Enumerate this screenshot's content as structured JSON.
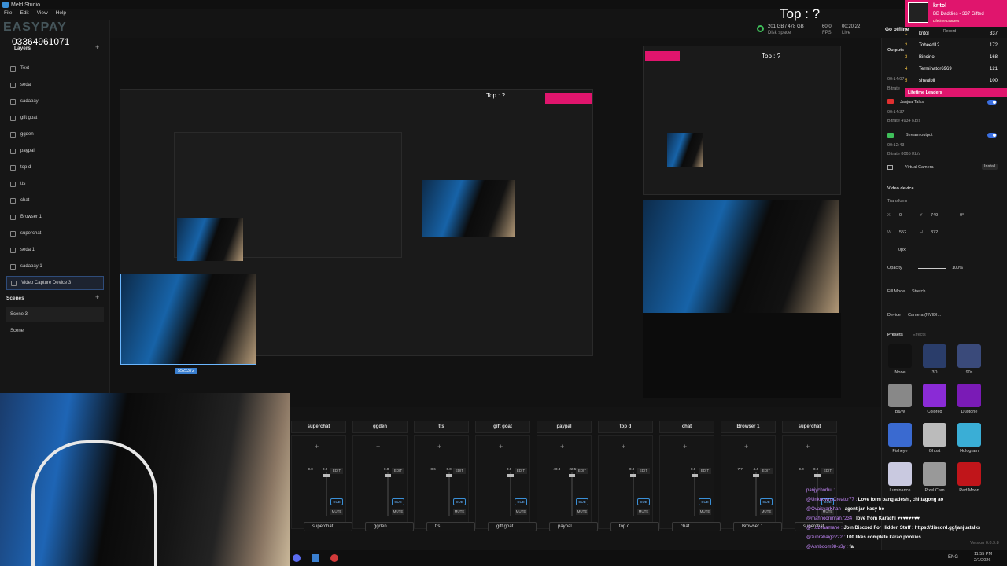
{
  "window": {
    "title": "Meld Studio"
  },
  "menu": [
    "File",
    "Edit",
    "View",
    "Help"
  ],
  "watermark": {
    "brand": "EASYPAY",
    "phone": "03364961071"
  },
  "layers": {
    "title": "Layers",
    "items": [
      "Text",
      "seda",
      "sadapay",
      "gift goat",
      "ggden",
      "paypal",
      "top d",
      "tts",
      "chat",
      "Browser 1",
      "superchat",
      "seda 1",
      "sadapay 1",
      "Video Capture Device 3"
    ]
  },
  "scenes": {
    "title": "Scenes",
    "items": [
      "Scene 3",
      "Scene"
    ]
  },
  "overlay": {
    "top_text": "Top : ?"
  },
  "stats": {
    "disk": "201 GB / 478 GB",
    "disk_label": "Disk space",
    "fps": "60.0",
    "fps_label": "FPS",
    "time": "00:20:22",
    "live_label": "Live",
    "go_offline": "Go offline",
    "record": "Record"
  },
  "leaderboard": {
    "name": "kritol",
    "subtitle": "BB Daddies - 337 Gifted",
    "sub2": "Lifetime Leaders",
    "rows": [
      {
        "rank": "1",
        "name": "kritol",
        "value": "337"
      },
      {
        "rank": "2",
        "name": "Toheed12",
        "value": "172"
      },
      {
        "rank": "3",
        "name": "Bincino",
        "value": "168"
      },
      {
        "rank": "4",
        "name": "Terminator6969",
        "value": "121"
      },
      {
        "rank": "5",
        "name": "sheaibii",
        "value": "100"
      }
    ],
    "footer": "Lifetime Leaders"
  },
  "outputs": {
    "title": "Outputs",
    "items": [
      {
        "name": "Janjua Talks",
        "time": "00:14:37",
        "bitrate": "Bitrate  4934 Kb/s"
      },
      {
        "name": "Stream output",
        "time": "00:12:43",
        "bitrate": "Bitrate  8065 Kb/s"
      },
      {
        "name": "Virtual Camera",
        "action": "Install"
      }
    ],
    "time1": "00:14:07",
    "bitrate1": "Bitrate"
  },
  "video_device": {
    "title": "Video device",
    "transform": "Transform",
    "x": "0",
    "y": "749",
    "rot": "0°",
    "w": "552",
    "h": "372",
    "crop": "0px",
    "opacity_label": "Opacity",
    "opacity": "100%",
    "fill_label": "Fill Mode",
    "fill": "Stretch",
    "device_label": "Device",
    "device": "Camera (NVIDI...",
    "presets_tab": "Presets",
    "effects_tab": "Effects",
    "presets": [
      "None",
      "3D",
      "90s",
      "B&W",
      "Colored",
      "Duotone",
      "Fisheye",
      "Ghost",
      "Hologram",
      "Luminance",
      "Pixel Cam",
      "Red Moon"
    ],
    "version": "Version 0.8.9.8"
  },
  "selection_size": "552x372",
  "mixer": {
    "channels": [
      {
        "title": "superchat",
        "name": "superchat",
        "db1": "-9.0",
        "db2": "0.0"
      },
      {
        "title": "ggden",
        "name": "ggden",
        "db1": "",
        "db2": "0.0"
      },
      {
        "title": "tts",
        "name": "tts",
        "db1": "-8.6",
        "db2": "-0.0"
      },
      {
        "title": "gift goat",
        "name": "gift goat",
        "db1": "",
        "db2": "0.0"
      },
      {
        "title": "paypal",
        "name": "paypal",
        "db1": "-40.3",
        "db2": "-22.5"
      },
      {
        "title": "top d",
        "name": "top d",
        "db1": "",
        "db2": "0.0"
      },
      {
        "title": "chat",
        "name": "chat",
        "db1": "",
        "db2": "0.0"
      },
      {
        "title": "Browser 1",
        "name": "Browser 1",
        "db1": "-7.7",
        "db2": "-4.4"
      },
      {
        "title": "superchat",
        "name": "superchat",
        "db1": "-9.0",
        "db2": "0.0"
      }
    ],
    "edit": "EDIT",
    "cue": "CUE",
    "mute": "MUTE"
  },
  "chat": [
    {
      "user": "panjychorhu :",
      "msg": ""
    },
    {
      "user": "@UnknownsCreator77 :",
      "msg": "Love form bangladesh , chittagong ao"
    },
    {
      "user": "@OvaisyarKhan :",
      "msg": "agent jan kasy ho"
    },
    {
      "user": "@mahnoorimran7234 :",
      "msg": "love from Karachi ♥♥♥♥♥♥♥♥"
    },
    {
      "user": "@...dzeaamahe :",
      "msg": "Join Discord For Hidden Stuff : https://discord.gg/janjuatalks"
    },
    {
      "user": "@zuhrabaig2222 :",
      "msg": "100 likes complete karao pookies"
    },
    {
      "user": "@Ashboom98-s3y :",
      "msg": "fa"
    },
    {
      "user": "BORON :",
      "msg": "achi baat hai"
    }
  ],
  "tray": {
    "lang": "ENG",
    "time": "11:55 PM",
    "date": "2/1/2026"
  },
  "colors": {
    "accent": "#e0156d",
    "blue": "#3b6fe0",
    "bg": "#141414"
  }
}
